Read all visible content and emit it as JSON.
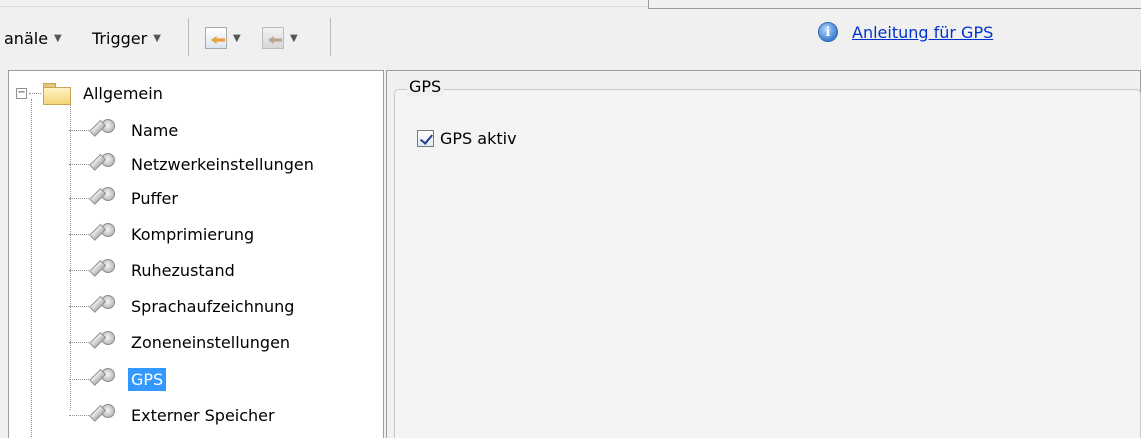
{
  "toolbar": {
    "channels_label": "anäle",
    "trigger_label": "Trigger",
    "help_link": "Anleitung für GPS"
  },
  "tree": {
    "root_label": "Allgemein",
    "items": [
      {
        "label": "Name",
        "selected": false
      },
      {
        "label": "Netzwerkeinstellungen",
        "selected": false
      },
      {
        "label": "Puffer",
        "selected": false
      },
      {
        "label": "Komprimierung",
        "selected": false
      },
      {
        "label": "Ruhezustand",
        "selected": false
      },
      {
        "label": "Sprachaufzeichnung",
        "selected": false
      },
      {
        "label": "Zoneneinstellungen",
        "selected": false
      },
      {
        "label": "GPS",
        "selected": true
      },
      {
        "label": "Externer Speicher",
        "selected": false
      }
    ]
  },
  "gps": {
    "group_title": "GPS",
    "checkbox_label": "GPS aktiv",
    "checked": true
  }
}
